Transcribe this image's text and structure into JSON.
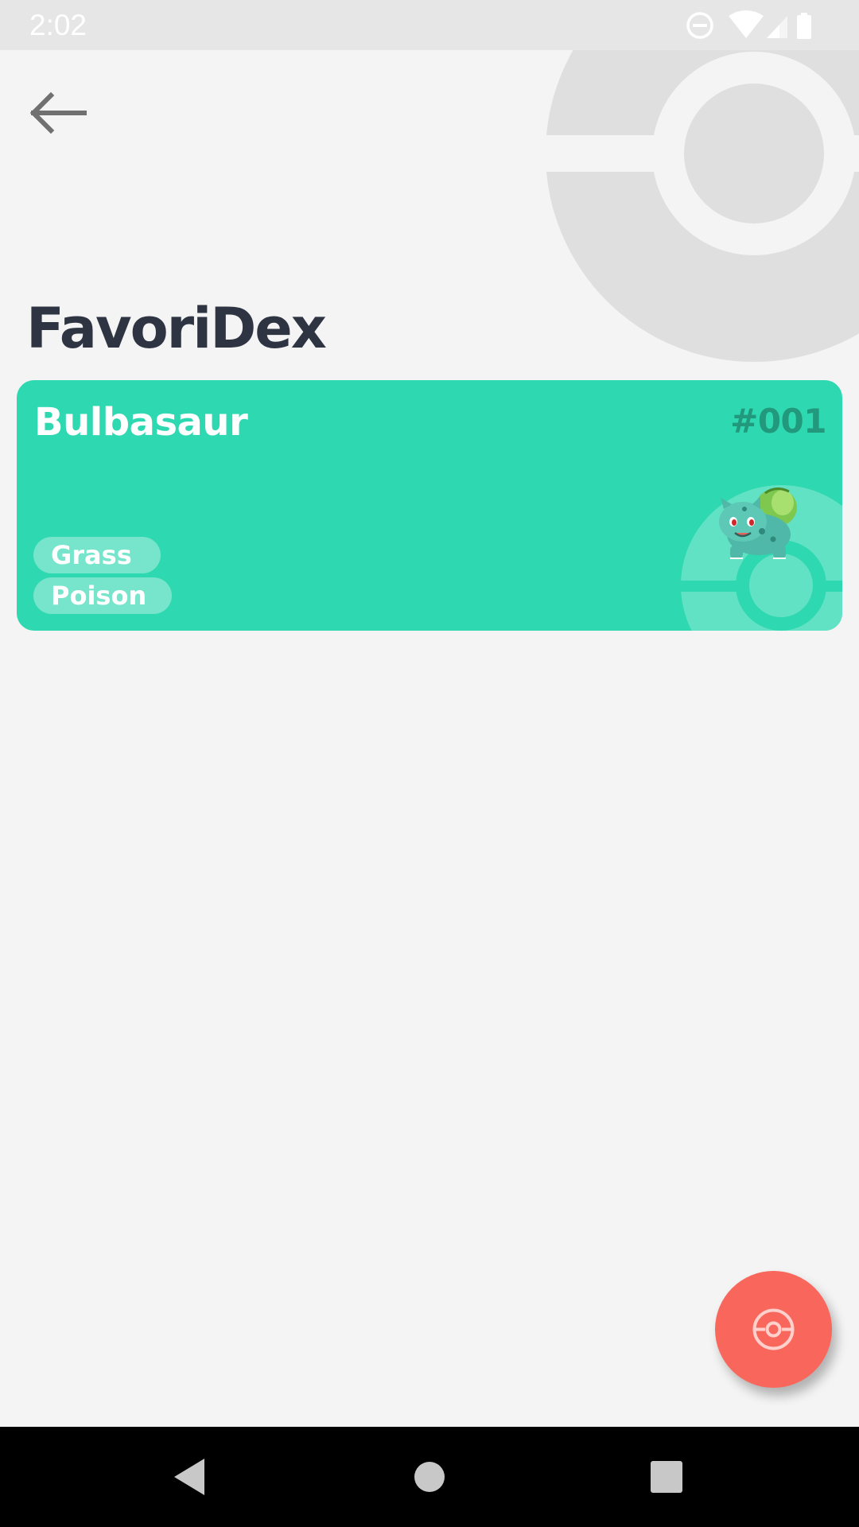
{
  "status_bar": {
    "time": "2:02",
    "icons": [
      "do-not-disturb-icon",
      "wifi-icon",
      "signal-icon",
      "battery-icon"
    ]
  },
  "header": {
    "back_icon": "arrow-back-icon",
    "title": "FavoriDex"
  },
  "favorites": [
    {
      "name": "Bulbasaur",
      "number": "#001",
      "types": [
        "Grass",
        "Poison"
      ],
      "card_color": "#2ed8b0",
      "number_color": "#22997c"
    }
  ],
  "fab": {
    "icon": "pokeball-icon",
    "color": "#f9675c"
  },
  "nav_bar": {
    "buttons": [
      "back-triangle-icon",
      "home-circle-icon",
      "recents-square-icon"
    ]
  },
  "colors": {
    "background": "#f4f4f4",
    "title": "#2e3442",
    "header_pokeball": "#dfdfdf"
  }
}
